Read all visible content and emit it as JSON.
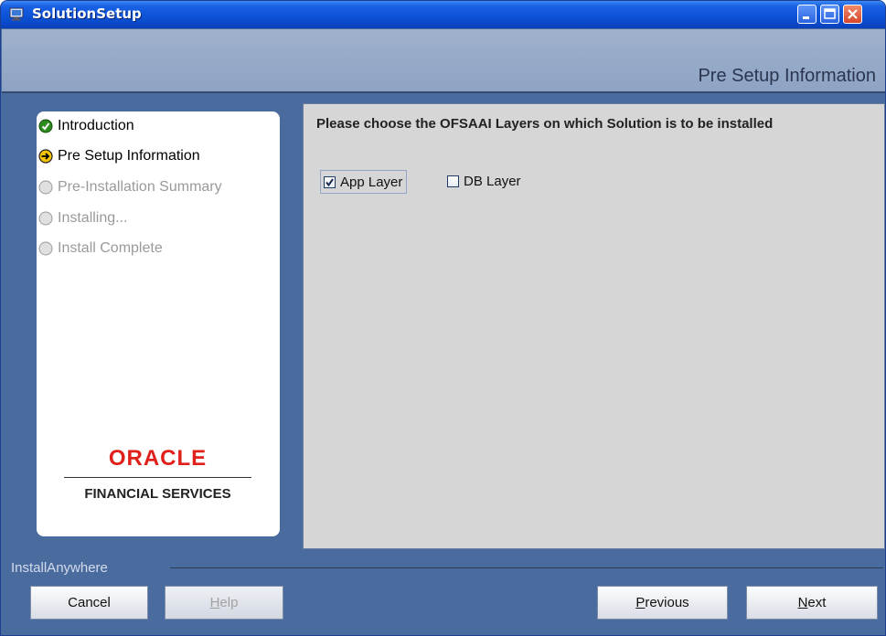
{
  "window": {
    "title": "SolutionSetup",
    "controls": [
      "minimize-icon",
      "maximize-icon",
      "close-icon"
    ]
  },
  "header": {
    "title": "Pre Setup Information"
  },
  "steps": [
    {
      "label": "Introduction",
      "status": "done"
    },
    {
      "label": "Pre Setup Information",
      "status": "current"
    },
    {
      "label": "Pre-Installation Summary",
      "status": "pending"
    },
    {
      "label": "Installing...",
      "status": "pending"
    },
    {
      "label": "Install Complete",
      "status": "pending"
    }
  ],
  "logo": {
    "brand": "ORACLE",
    "subtitle": "FINANCIAL SERVICES"
  },
  "content": {
    "prompt": "Please choose the OFSAAI Layers on which Solution is to be installed",
    "options": [
      {
        "label": "App Layer",
        "checked": true
      },
      {
        "label": "DB Layer",
        "checked": false
      }
    ]
  },
  "footer": {
    "brand_label": "InstallAnywhere",
    "buttons": {
      "cancel": "Cancel",
      "help_prefix": "",
      "help_mnemonic": "H",
      "help_rest": "elp",
      "previous_mnemonic": "P",
      "previous_rest": "revious",
      "next_mnemonic": "N",
      "next_rest": "ext"
    }
  },
  "colors": {
    "titlebar": "#0d53d8",
    "header_strip": "#9fb1cc",
    "window_bg": "#4a6b9e",
    "content_bg": "#d6d6d6",
    "oracle_red": "#e0201b",
    "check_green": "#2e8b1e",
    "arrow_yellow": "#f5c400"
  }
}
